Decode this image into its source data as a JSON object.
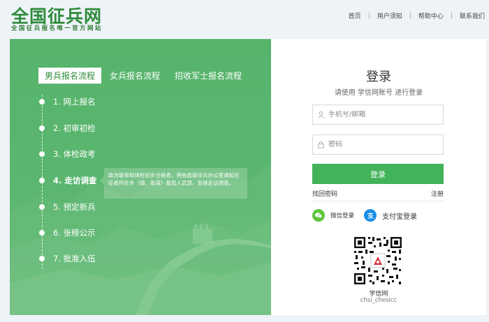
{
  "header": {
    "logo_title": "全国征兵网",
    "logo_subtitle": "全国征兵报名唯一官方网站",
    "nav": [
      "首页",
      "用户须知",
      "帮助中心",
      "联系我们"
    ]
  },
  "tabs": [
    {
      "label": "男兵报名流程",
      "active": true
    },
    {
      "label": "女兵报名流程",
      "active": false
    },
    {
      "label": "招收军士报名流程",
      "active": false
    }
  ],
  "steps": [
    {
      "label": "1. 网上报名"
    },
    {
      "label": "2. 初审初检"
    },
    {
      "label": "3. 体检政考"
    },
    {
      "label": "4. 走访调查",
      "active": true
    },
    {
      "label": "5. 预定新兵"
    },
    {
      "label": "6. 张榜公示"
    },
    {
      "label": "7. 批准入伍"
    }
  ],
  "tooltip": "政治联审和体检初步合格者，将由县级征兵办公室通知应征者所在乡（镇、街道）基层人武部，安排走访调查。",
  "login": {
    "title": "登录",
    "subtitle": "请使用 学信网账号 进行登录",
    "username_placeholder": "手机号/邮箱",
    "password_placeholder": "密码",
    "button": "登录",
    "forgot": "找回密码",
    "register": "注册",
    "wechat": "微信登录",
    "alipay": "支付宝登录",
    "qr_name": "学信网",
    "qr_id": "chsi_chesicc"
  },
  "colors": {
    "primary_green": "#43b35a",
    "panel_green": "#5bb670",
    "logo_green": "#2e8b3a"
  },
  "icons": {
    "user": "user-icon",
    "lock": "lock-icon",
    "wechat": "wechat-icon",
    "alipay": "alipay-icon"
  }
}
